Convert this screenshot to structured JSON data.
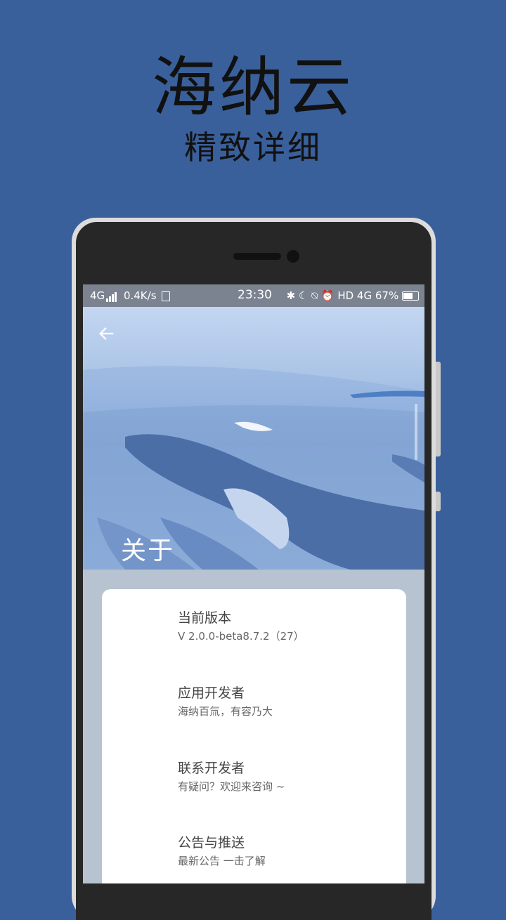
{
  "promo": {
    "title": "海纳云",
    "subtitle": "精致详细"
  },
  "statusbar": {
    "network": "4G",
    "speed": "0.4K/s",
    "time": "23:30",
    "right_icons": "✱ ☾ ⍉ ⏰ HD 4G",
    "battery": "67%"
  },
  "header": {
    "back_icon": "arrow-left-icon",
    "title": "关于"
  },
  "items": [
    {
      "title": "当前版本",
      "subtitle": "V 2.0.0-beta8.7.2（27）"
    },
    {
      "title": "应用开发者",
      "subtitle": "海纳百氚，有容乃大"
    },
    {
      "title": "联系开发者",
      "subtitle": "有疑问？欢迎来咨询 ~"
    },
    {
      "title": "公告与推送",
      "subtitle": "最新公告 一击了解"
    }
  ],
  "colors": {
    "background": "#3a609c",
    "statusbar": "#7b8390",
    "screen_bg": "#b7c3d0",
    "card": "#ffffff"
  }
}
